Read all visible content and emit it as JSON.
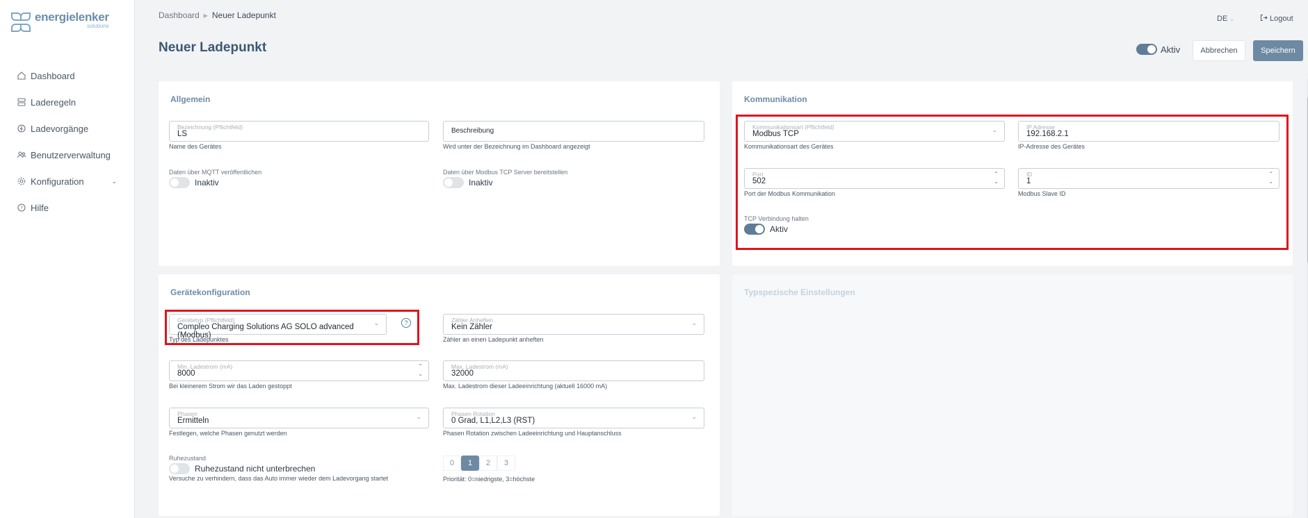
{
  "logo": {
    "name": "energielenker",
    "sub": "solutions"
  },
  "sidebar": {
    "items": [
      {
        "label": "Dashboard",
        "icon": "home-icon"
      },
      {
        "label": "Laderegeln",
        "icon": "rules-icon"
      },
      {
        "label": "Ladevorgänge",
        "icon": "charging-icon"
      },
      {
        "label": "Benutzerverwaltung",
        "icon": "users-icon"
      },
      {
        "label": "Konfiguration",
        "icon": "gear-icon"
      },
      {
        "label": "Hilfe",
        "icon": "help-icon"
      }
    ]
  },
  "breadcrumb": {
    "root": "Dashboard",
    "current": "Neuer Ladepunkt"
  },
  "page_title": "Neuer Ladepunkt",
  "header": {
    "lang": "DE",
    "logout": "Logout",
    "active_label": "Aktiv",
    "cancel": "Abbrechen",
    "save": "Speichern"
  },
  "allgemein": {
    "title": "Allgemein",
    "bezeichnung": {
      "label": "Bezeichnung (Pflichtfeld)",
      "value": "LS",
      "hint": "Name des Gerätes"
    },
    "beschreibung": {
      "placeholder": "Beschreibung",
      "hint": "Wird unter der Bezeichnung im Dashboard angezeigt"
    },
    "mqtt": {
      "label": "Daten über MQTT veröffentlichen",
      "state": "Inaktiv"
    },
    "modbus": {
      "label": "Daten über Modbus TCP Server bereitstellen",
      "state": "Inaktiv"
    }
  },
  "kommunikation": {
    "title": "Kommunikation",
    "art": {
      "label": "Kommunikationsart (Pflichtfeld)",
      "value": "Modbus TCP",
      "hint": "Kommunikationsart des Gerätes"
    },
    "ip": {
      "label": "IP Adresse",
      "value": "192.168.2.1",
      "hint": "IP-Adresse des Gerätes"
    },
    "port": {
      "label": "Port",
      "value": "502",
      "hint": "Port der Modbus Kommunikation"
    },
    "id": {
      "label": "ID",
      "value": "1",
      "hint": "Modbus Slave ID"
    },
    "tcp": {
      "label": "TCP Verbindung halten",
      "state": "Aktiv"
    }
  },
  "geraet": {
    "title": "Gerätekonfiguration",
    "typ": {
      "label": "Gerätetyp (Pflichtfeld)",
      "value": "Compleo Charging Solutions AG SOLO advanced (Modbus)",
      "hint": "Typ des Ladepunktes"
    },
    "zaehler": {
      "label": "Zähler Anheften",
      "value": "Kein Zähler",
      "hint": "Zähler an einen Ladepunkt anheften"
    },
    "min": {
      "label": "Min. Ladestrom (mA)",
      "value": "8000",
      "hint": "Bei kleinerem Strom wir das Laden gestoppt"
    },
    "max": {
      "label": "Max. Ladestrom (mA)",
      "value": "32000",
      "hint": "Max. Ladestrom dieser Ladeeinrichtung (aktuell 16000 mA)"
    },
    "phasen": {
      "label": "Phasen",
      "value": "Ermitteln",
      "hint": "Festlegen, welche Phasen genutzt werden"
    },
    "rotation": {
      "label": "Phasen Rotation",
      "value": "0 Grad, L1,L2,L3 (RST)",
      "hint": "Phasen Rotation zwischen Ladeeinrichtung und Hauptanschluss"
    },
    "ruhe": {
      "label": "Ruhezustand",
      "state": "Ruhezustand nicht unterbrechen",
      "hint": "Versuche zu verhindern, dass das Auto immer wieder dem Ladevorgang startet"
    },
    "prio": {
      "options": [
        "0",
        "1",
        "2",
        "3"
      ],
      "selected": "1",
      "hint": "Priorität: 0=niedrigste, 3=höchste"
    }
  },
  "typ_settings": {
    "title": "Typspezische Einstellungen"
  }
}
